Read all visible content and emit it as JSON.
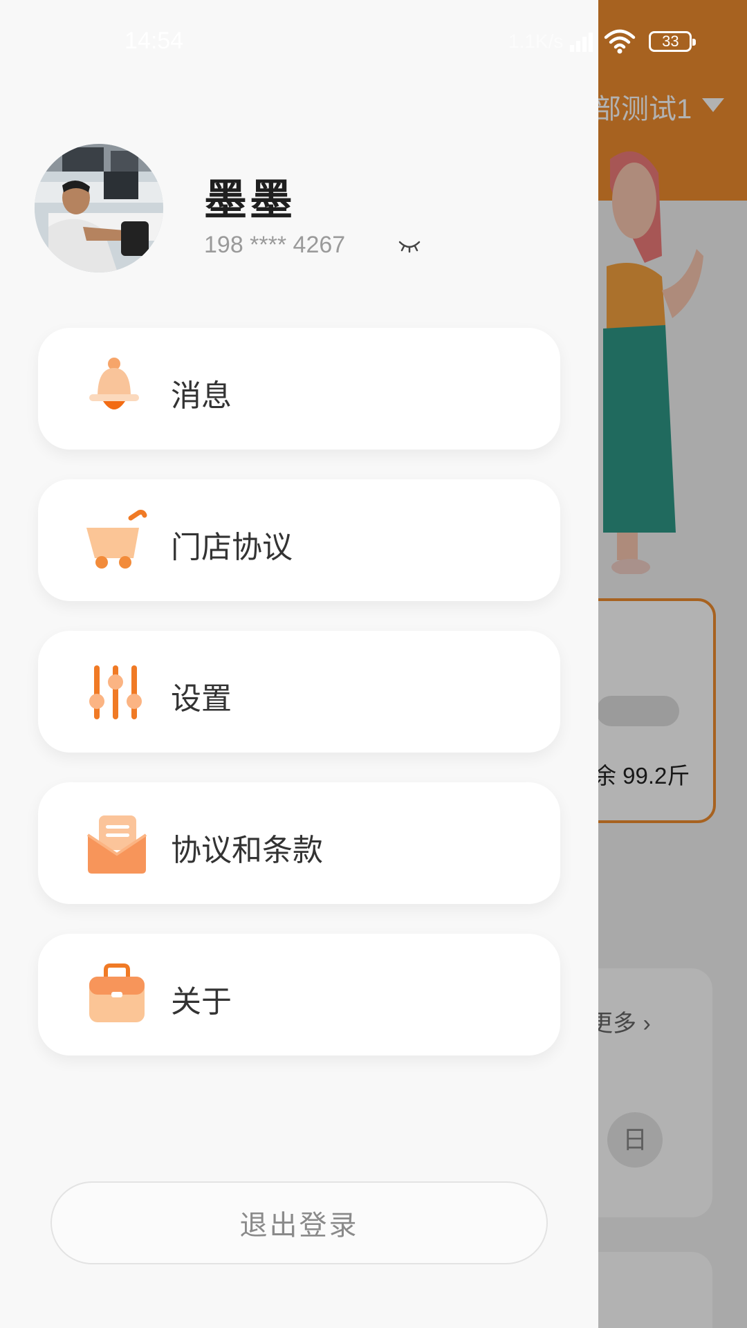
{
  "status_bar": {
    "time": "14:54",
    "network": "1.1K/s",
    "battery": "33"
  },
  "background_app": {
    "store_selector": "部测试1",
    "weight_text": "余 99.2斤",
    "more_link": "更多 ›",
    "day_button": "日",
    "accent_color": "#ef8d2e"
  },
  "drawer": {
    "user": {
      "name": "墨墨",
      "phone": "198 **** 4267"
    },
    "menu": [
      {
        "label": "消息",
        "icon": "bell-icon"
      },
      {
        "label": "门店协议",
        "icon": "cart-icon"
      },
      {
        "label": "设置",
        "icon": "sliders-icon"
      },
      {
        "label": "协议和条款",
        "icon": "envelope-icon"
      },
      {
        "label": "关于",
        "icon": "briefcase-icon"
      }
    ],
    "logout_label": "退出登录"
  }
}
